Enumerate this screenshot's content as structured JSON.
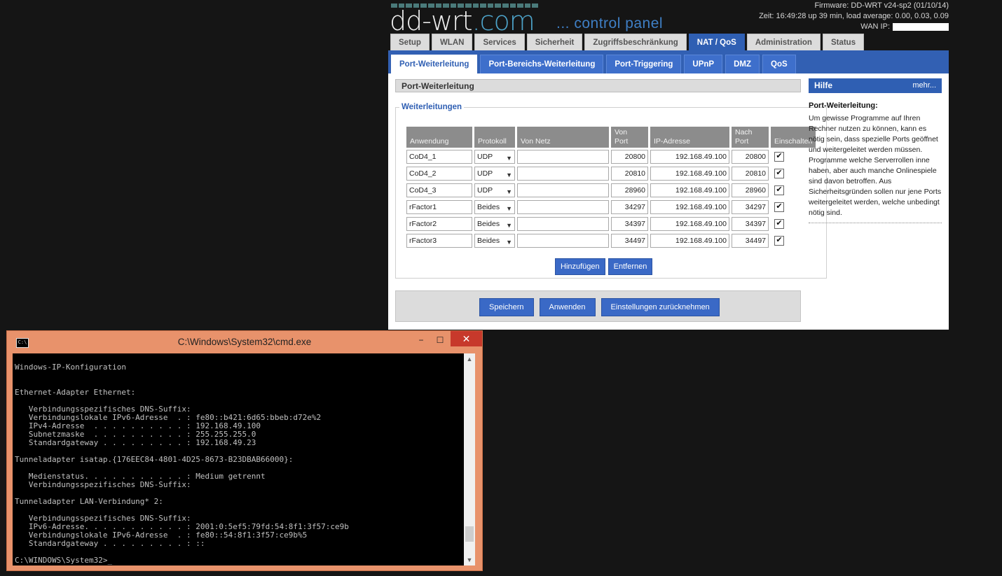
{
  "ddwrt": {
    "logo_main": "dd-wrt",
    "logo_dotcom": ".com",
    "subtitle": "... control panel",
    "firmware": "Firmware: DD-WRT v24-sp2 (01/10/14)",
    "uptime": "Zeit: 16:49:28 up 39 min, load average: 0.00, 0.03, 0.09",
    "wan_ip_label": "WAN IP:",
    "main_tabs": [
      "Setup",
      "WLAN",
      "Services",
      "Sicherheit",
      "Zugriffsbeschränkung",
      "NAT / QoS",
      "Administration",
      "Status"
    ],
    "active_main_tab": "NAT / QoS",
    "sub_tabs": [
      "Port-Weiterleitung",
      "Port-Bereichs-Weiterleitung",
      "Port-Triggering",
      "UPnP",
      "DMZ",
      "QoS"
    ],
    "active_sub_tab": "Port-Weiterleitung",
    "section_title": "Port-Weiterleitung",
    "fieldset_legend": "Weiterleitungen",
    "columns": {
      "app": "Anwendung",
      "proto": "Protokoll",
      "net": "Von Netz",
      "from_port_1": "Von",
      "from_port_2": "Port",
      "ip": "IP-Adresse",
      "to_port_1": "Nach",
      "to_port_2": "Port",
      "enable": "Einschalten"
    },
    "rows": [
      {
        "app": "CoD4_1",
        "proto": "UDP",
        "net": "",
        "from": "20800",
        "ip": "192.168.49.100",
        "to": "20800",
        "enabled": "✔"
      },
      {
        "app": "CoD4_2",
        "proto": "UDP",
        "net": "",
        "from": "20810",
        "ip": "192.168.49.100",
        "to": "20810",
        "enabled": "✔"
      },
      {
        "app": "CoD4_3",
        "proto": "UDP",
        "net": "",
        "from": "28960",
        "ip": "192.168.49.100",
        "to": "28960",
        "enabled": "✔"
      },
      {
        "app": "rFactor1",
        "proto": "Beides",
        "net": "",
        "from": "34297",
        "ip": "192.168.49.100",
        "to": "34297",
        "enabled": "✔"
      },
      {
        "app": "rFactor2",
        "proto": "Beides",
        "net": "",
        "from": "34397",
        "ip": "192.168.49.100",
        "to": "34397",
        "enabled": "✔"
      },
      {
        "app": "rFactor3",
        "proto": "Beides",
        "net": "",
        "from": "34497",
        "ip": "192.168.49.100",
        "to": "34497",
        "enabled": "✔"
      }
    ],
    "add_label": "Hinzufügen",
    "remove_label": "Entfernen",
    "save_label": "Speichern",
    "apply_label": "Anwenden",
    "reset_label": "Einstellungen zurücknehmen",
    "help": {
      "head": "Hilfe",
      "more": "mehr...",
      "title": "Port-Weiterleitung:",
      "text": "Um gewisse Programme auf Ihren Rechner nutzen zu können, kann es nötig sein, dass spezielle Ports geöffnet und weitergeleitet werden müssen. Programme welche Serverrollen inne haben, aber auch manche Onlinespiele sind davon betroffen. Aus Sicherheitsgründen sollen nur jene Ports weitergeleitet werden, welche unbedingt nötig sind."
    }
  },
  "cmd": {
    "title": "C:\\Windows\\System32\\cmd.exe",
    "min_glyph": "−",
    "max_glyph": "☐",
    "close_glyph": "✕",
    "output": "Windows-IP-Konfiguration\n\n\nEthernet-Adapter Ethernet:\n\n   Verbindungsspezifisches DNS-Suffix:\n   Verbindungslokale IPv6-Adresse  . : fe80::b421:6d65:bbeb:d72e%2\n   IPv4-Adresse  . . . . . . . . . . : 192.168.49.100\n   Subnetzmaske  . . . . . . . . . . : 255.255.255.0\n   Standardgateway . . . . . . . . . : 192.168.49.23\n\nTunneladapter isatap.{176EEC84-4801-4D25-8673-B23DBAB66000}:\n\n   Medienstatus. . . . . . . . . . . : Medium getrennt\n   Verbindungsspezifisches DNS-Suffix:\n\nTunneladapter LAN-Verbindung* 2:\n\n   Verbindungsspezifisches DNS-Suffix:\n   IPv6-Adresse. . . . . . . . . . . : 2001:0:5ef5:79fd:54:8f1:3f57:ce9b\n   Verbindungslokale IPv6-Adresse  . : fe80::54:8f1:3f57:ce9b%5\n   Standardgateway . . . . . . . . . : ::\n\nC:\\WINDOWS\\System32>_"
  }
}
